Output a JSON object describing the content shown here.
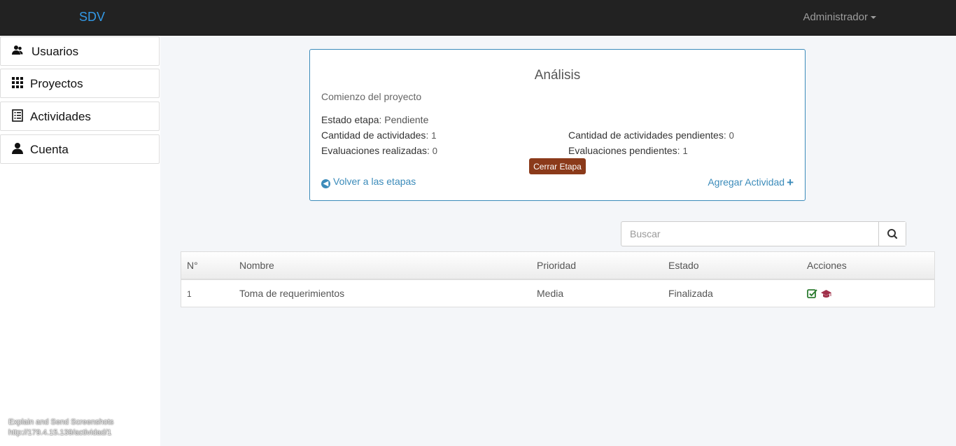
{
  "navbar": {
    "brand": "SDV",
    "user_menu": "Administrador",
    "brand_color": "#3399e6"
  },
  "sidebar": {
    "items": [
      {
        "label": "Usuarios",
        "icon": "users-icon"
      },
      {
        "label": "Proyectos",
        "icon": "grid-icon"
      },
      {
        "label": "Actividades",
        "icon": "list-icon"
      },
      {
        "label": "Cuenta",
        "icon": "user-icon"
      }
    ]
  },
  "footer_note": {
    "line1": "Explain and Send Screenshots",
    "line2": "http://179.4.15.139/actividad/1"
  },
  "stage": {
    "title": "Análisis",
    "description": "Comienzo del proyecto",
    "estado_label": "Estado etapa",
    "estado_value": "Pendiente",
    "cant_act_label": "Cantidad de actividades",
    "cant_act_value": "1",
    "cant_pend_label": "Cantidad de actividades pendientes",
    "cant_pend_value": "0",
    "eval_real_label": "Evaluaciones realizadas",
    "eval_real_value": "0",
    "eval_pend_label": "Evaluaciones pendientes",
    "eval_pend_value": "1",
    "close_button": "Cerrar Etapa",
    "back_link": "Volver a las etapas",
    "add_link": "Agregar Actividad",
    "accent_color": "#3b8bba",
    "close_button_color": "#8b3a1a"
  },
  "search": {
    "placeholder": "Buscar"
  },
  "table": {
    "headers": [
      "N°",
      "Nombre",
      "Prioridad",
      "Estado",
      "Acciones"
    ],
    "rows": [
      {
        "num": "1",
        "nombre": "Toma de requerimientos",
        "prioridad": "Media",
        "estado": "Finalizada",
        "actions": [
          "edit-check-icon",
          "graduation-cap-icon"
        ]
      }
    ]
  }
}
